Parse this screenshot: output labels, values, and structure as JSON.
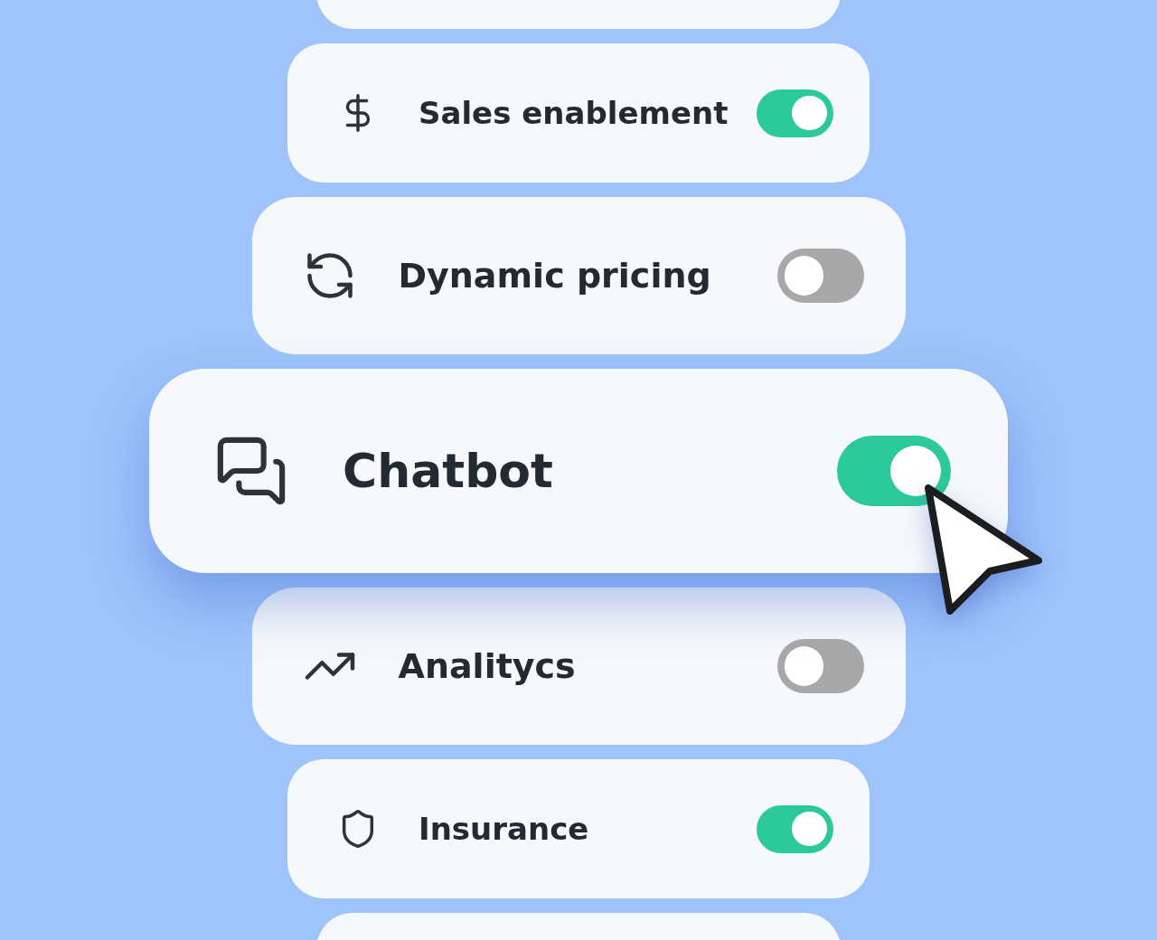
{
  "features": [
    {
      "label": "Sales enablement",
      "on": true,
      "kind": "compact"
    },
    {
      "label": "Dynamic pricing",
      "on": false,
      "kind": "regular"
    },
    {
      "label": "Chatbot",
      "on": true,
      "kind": "featured"
    },
    {
      "label": "Analitycs",
      "on": false,
      "kind": "regular"
    },
    {
      "label": "Insurance",
      "on": true,
      "kind": "compact"
    }
  ]
}
